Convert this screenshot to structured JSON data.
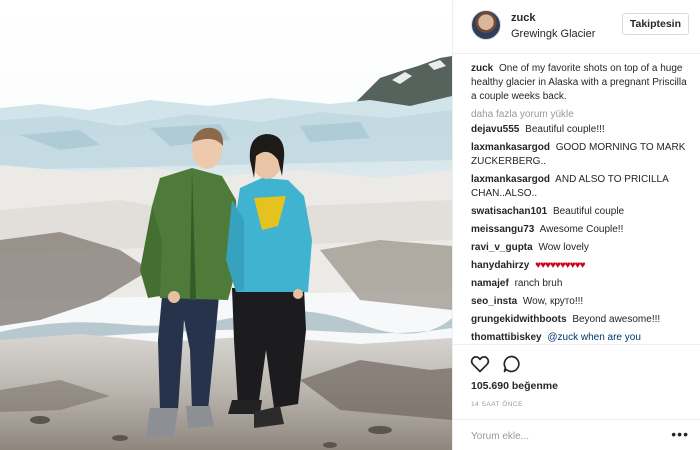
{
  "post": {
    "username": "zuck",
    "location": "Grewingk Glacier",
    "follow_label": "Takiptesin",
    "caption_user": "zuck",
    "caption_text": "One of my favorite shots on top of a huge healthy glacier in Alaska with a pregnant Priscilla a couple weeks back.",
    "load_more": "daha fazla yorum yükle",
    "comments": [
      {
        "user": "dejavu555",
        "text": "Beautiful couple!!!"
      },
      {
        "user": "laxmankasargod",
        "text": "GOOD MORNING TO MARK ZUCKERBERG.."
      },
      {
        "user": "laxmankasargod",
        "text": "AND ALSO TO PRICILLA CHAN..ALSO.."
      },
      {
        "user": "swatisachan101",
        "text": "Beautiful couple"
      },
      {
        "user": "meissangu73",
        "text": "Awesome Couple!!"
      },
      {
        "user": "ravi_v_gupta",
        "text": "Wow lovely"
      },
      {
        "user": "hanydahirzy",
        "text": "♥♥♥♥♥♥♥♥♥♥"
      },
      {
        "user": "namajef",
        "text": "ranch bruh"
      },
      {
        "user": "seo_insta",
        "text": "Wow, круто!!!"
      },
      {
        "user": "grungekidwithboots",
        "text": "Beyond awesome!!!"
      },
      {
        "user": "thomattibiskey",
        "text": "@zuck when are you"
      }
    ],
    "likes": "105.690 beğenme",
    "time": "14 SAAT ÖNCE",
    "comment_placeholder": "Yorum ekle...",
    "more_label": "•••",
    "icons": {
      "like": "heart-icon",
      "comment": "comment-icon",
      "more": "more-options-icon"
    }
  },
  "colors": {
    "border": "#efefef",
    "text": "#262626",
    "muted": "#999999",
    "heart": "#d0021b",
    "link": "#003569"
  }
}
